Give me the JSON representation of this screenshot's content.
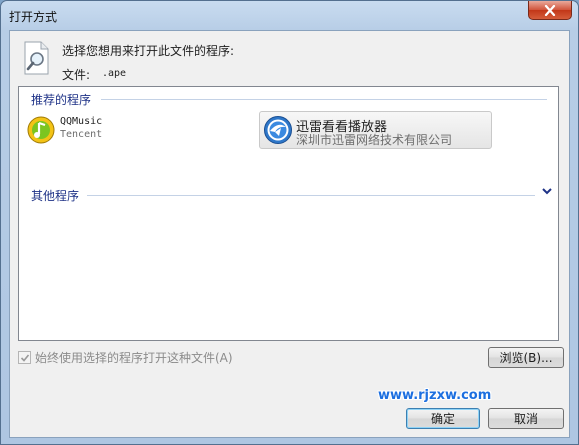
{
  "window": {
    "title": "打开方式",
    "close_icon": "close-icon"
  },
  "header": {
    "prompt": "选择您想用来打开此文件的程序:",
    "file_label": "文件:",
    "file_name": ".ape",
    "icon": "document-search-icon"
  },
  "recommended": {
    "header": "推荐的程序",
    "programs": [
      {
        "name": "QQMusic",
        "publisher": "Tencent",
        "icon": "qqmusic-icon"
      },
      {
        "name": "迅雷看看播放器",
        "publisher": "深圳市迅雷网络技术有限公司",
        "icon": "xunlei-player-icon"
      }
    ]
  },
  "other": {
    "header": "其他程序",
    "expand_icon": "chevron-down-icon"
  },
  "always_use": {
    "label": "始终使用选择的程序打开这种文件(A)",
    "checked": true,
    "enabled": false
  },
  "buttons": {
    "browse": "浏览(B)...",
    "ok": "确定",
    "cancel": "取消"
  },
  "watermark": "www.rjzxw.com",
  "colors": {
    "group_header": "#1e3287",
    "watermark": "#1c6fe0",
    "close_button": "#c23718"
  }
}
